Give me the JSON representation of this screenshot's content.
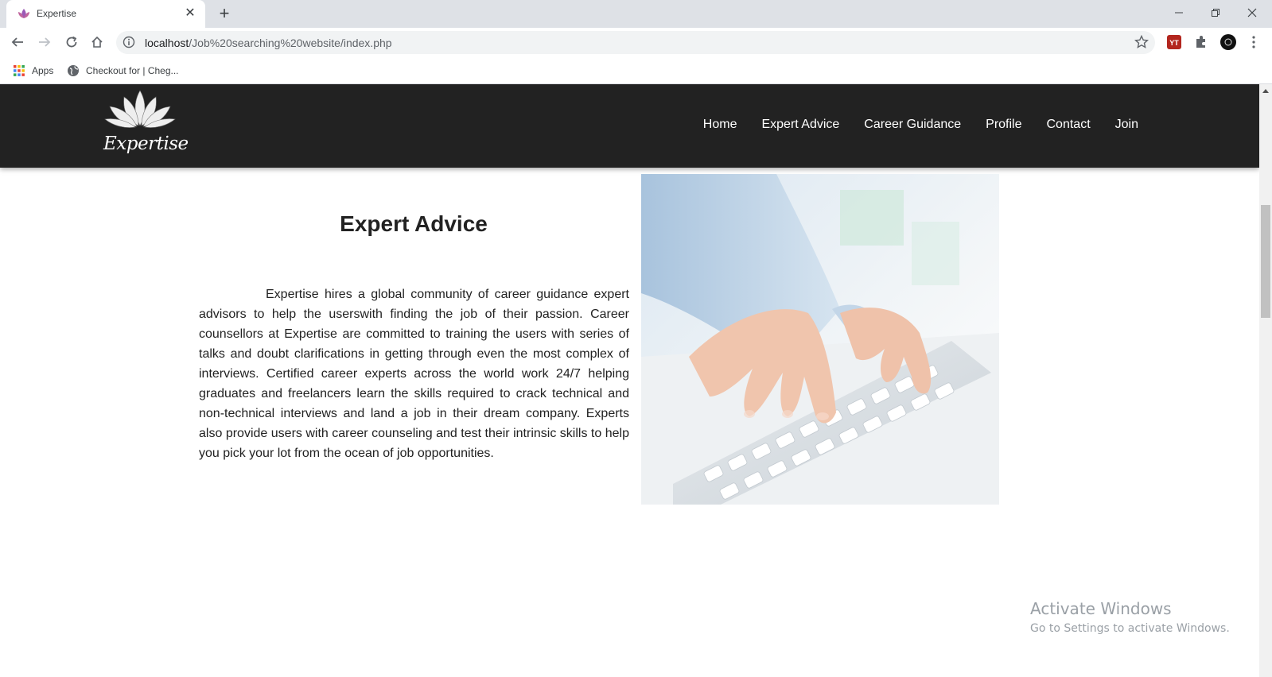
{
  "browser": {
    "tab_title": "Expertise",
    "tab_close": "✕",
    "new_tab": "+",
    "url_host": "localhost",
    "url_path": "/Job%20searching%20website/index.php",
    "bookmarks": [
      {
        "label": "Apps"
      },
      {
        "label": "Checkout for | Cheg..."
      }
    ]
  },
  "site": {
    "brand": "Expertise",
    "menu": [
      "Home",
      "Expert Advice",
      "Career Guidance",
      "Profile",
      "Contact",
      "Join"
    ],
    "nav_bg": "#222222"
  },
  "content": {
    "heading": "Expert Advice",
    "paragraph": "Expertise hires a global community of career guidance expert advisors to help the userswith finding the job of their passion. Career counsellors at Expertise are committed to training the users with series of talks and doubt clarifications in getting through even the most complex of interviews. Certified career experts across the world work 24/7 helping graduates and freelancers learn the skills required to crack technical and non-technical interviews and land a job in their dream company. Experts also provide users with career counseling and test their intrinsic skills to help you pick your lot from the ocean of job opportunities."
  },
  "watermark": {
    "line1": "Activate Windows",
    "line2": "Go to Settings to activate Windows."
  }
}
